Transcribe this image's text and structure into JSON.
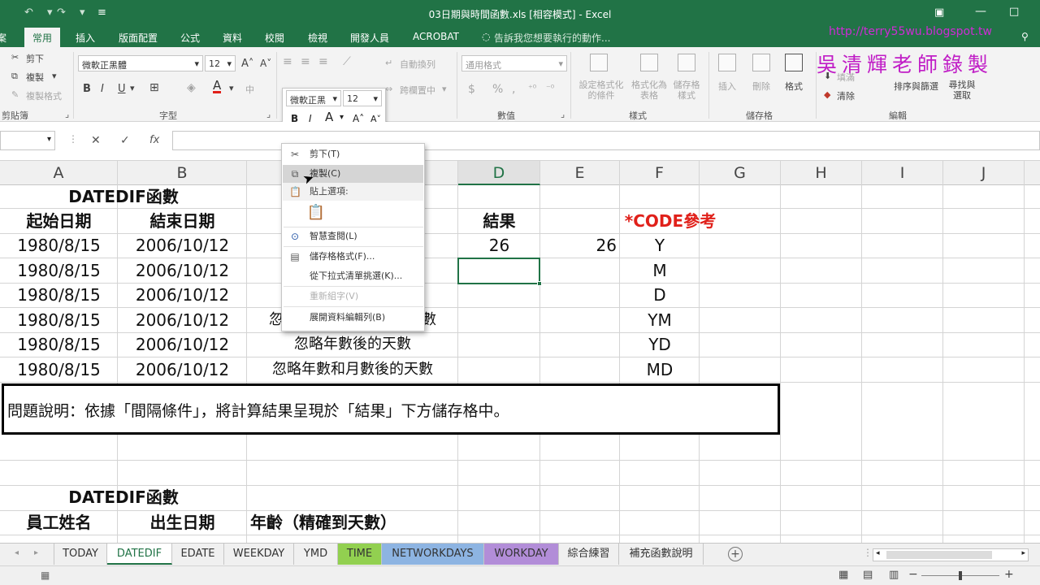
{
  "window": {
    "title": "03日期與時間函數.xls  [相容模式] - Excel"
  },
  "ribbon": {
    "tabs": [
      "常用",
      "插入",
      "版面配置",
      "公式",
      "資料",
      "校閱",
      "檢視",
      "開發人員",
      "ACROBAT"
    ],
    "tell_me": "告訴我您想要執行的動作...",
    "clipboard": {
      "cut": "剪下",
      "copy": "複製",
      "format_painter": "複製格式",
      "group": "剪貼簿"
    },
    "font": {
      "name": "微軟正黑體",
      "size": "12",
      "group": "字型",
      "bold": "B",
      "italic": "I",
      "underline": "U"
    },
    "alignment": {
      "wrap": "自動換列",
      "merge": "跨欄置中"
    },
    "number": {
      "format": "通用格式",
      "group": "數值",
      "currency": "$",
      "percent": "%",
      "comma": ","
    },
    "styles": {
      "conditional": "設定格式化的條件",
      "table": "格式化為表格",
      "cell_styles": "儲存格樣式",
      "group": "樣式"
    },
    "cells": {
      "insert": "插入",
      "delete": "刪除",
      "format": "格式",
      "group": "儲存格"
    },
    "editing": {
      "fill": "填滿",
      "clear": "清除",
      "sort": "排序與篩選",
      "find": "尋找與選取",
      "group": "編輯"
    }
  },
  "watermark": {
    "url": "http://terry55wu.blogspot.tw",
    "text": "吳清輝老師錄製"
  },
  "formula_bar": {
    "fx": "fx",
    "cancel": "✕",
    "enter": "✓"
  },
  "columns": [
    "A",
    "B",
    "C",
    "D",
    "E",
    "F",
    "G",
    "H",
    "I",
    "J"
  ],
  "grid": {
    "title": "DATEDIF函數",
    "headers": {
      "start": "起始日期",
      "end": "結束日期",
      "result": "結果",
      "code": "*CODE參考"
    },
    "rows": [
      {
        "start": "1980/8/15",
        "end": "2006/10/12",
        "c": "",
        "d": "26",
        "e": "26",
        "code": "Y"
      },
      {
        "start": "1980/8/15",
        "end": "2006/10/12",
        "c": "",
        "d": "",
        "e": "",
        "code": "M"
      },
      {
        "start": "1980/8/15",
        "end": "2006/10/12",
        "c": "",
        "d": "",
        "e": "",
        "code": "D"
      },
      {
        "start": "1980/8/15",
        "end": "2006/10/12",
        "c": "忽",
        "c_tail": "數",
        "d": "",
        "e": "",
        "code": "YM"
      },
      {
        "start": "1980/8/15",
        "end": "2006/10/12",
        "c": "忽略年數後的天數",
        "d": "",
        "e": "",
        "code": "YD"
      },
      {
        "start": "1980/8/15",
        "end": "2006/10/12",
        "c": "忽略年數和月數後的天數",
        "d": "",
        "e": "",
        "code": "MD"
      }
    ],
    "note": "問題說明：依據「間隔條件」，將計算結果呈現於「結果」下方儲存格中。",
    "title2": "DATEDIF函數",
    "headers2": {
      "name": "員工姓名",
      "birth": "出生日期",
      "age": "年齡（精確到天數）"
    }
  },
  "mini_toolbar": {
    "font": "微軟正黑",
    "size": "12",
    "bold": "B",
    "italic": "I",
    "font_color": "A"
  },
  "context_menu": [
    {
      "label": "剪下(T)",
      "icon": "scissors-icon",
      "state": "normal"
    },
    {
      "label": "複製(C)",
      "icon": "copy-icon",
      "state": "hover"
    },
    {
      "label": "貼上選項:",
      "icon": "paste-icon",
      "state": "dim"
    },
    {
      "label": "智慧查閱(L)",
      "icon": "smart-lookup-icon",
      "state": "normal"
    },
    {
      "label": "儲存格格式(F)...",
      "icon": "format-cells-icon",
      "state": "normal"
    },
    {
      "label": "從下拉式清單挑選(K)...",
      "icon": "",
      "state": "normal"
    },
    {
      "label": "重新組字(V)",
      "icon": "",
      "state": "dim"
    },
    {
      "label": "展開資料編輯列(B)",
      "icon": "",
      "state": "normal"
    }
  ],
  "sheets": [
    {
      "name": "TODAY",
      "color": ""
    },
    {
      "name": "DATEDIF",
      "color": "",
      "active": true
    },
    {
      "name": "EDATE",
      "color": ""
    },
    {
      "name": "WEEKDAY",
      "color": ""
    },
    {
      "name": "YMD",
      "color": ""
    },
    {
      "name": "TIME",
      "color": "#92d050"
    },
    {
      "name": "NETWORKDAYS",
      "color": "#8db4e2"
    },
    {
      "name": "WORKDAY",
      "color": "#b28dd8"
    },
    {
      "name": "綜合練習",
      "color": ""
    },
    {
      "name": "補充函數說明",
      "color": ""
    }
  ]
}
